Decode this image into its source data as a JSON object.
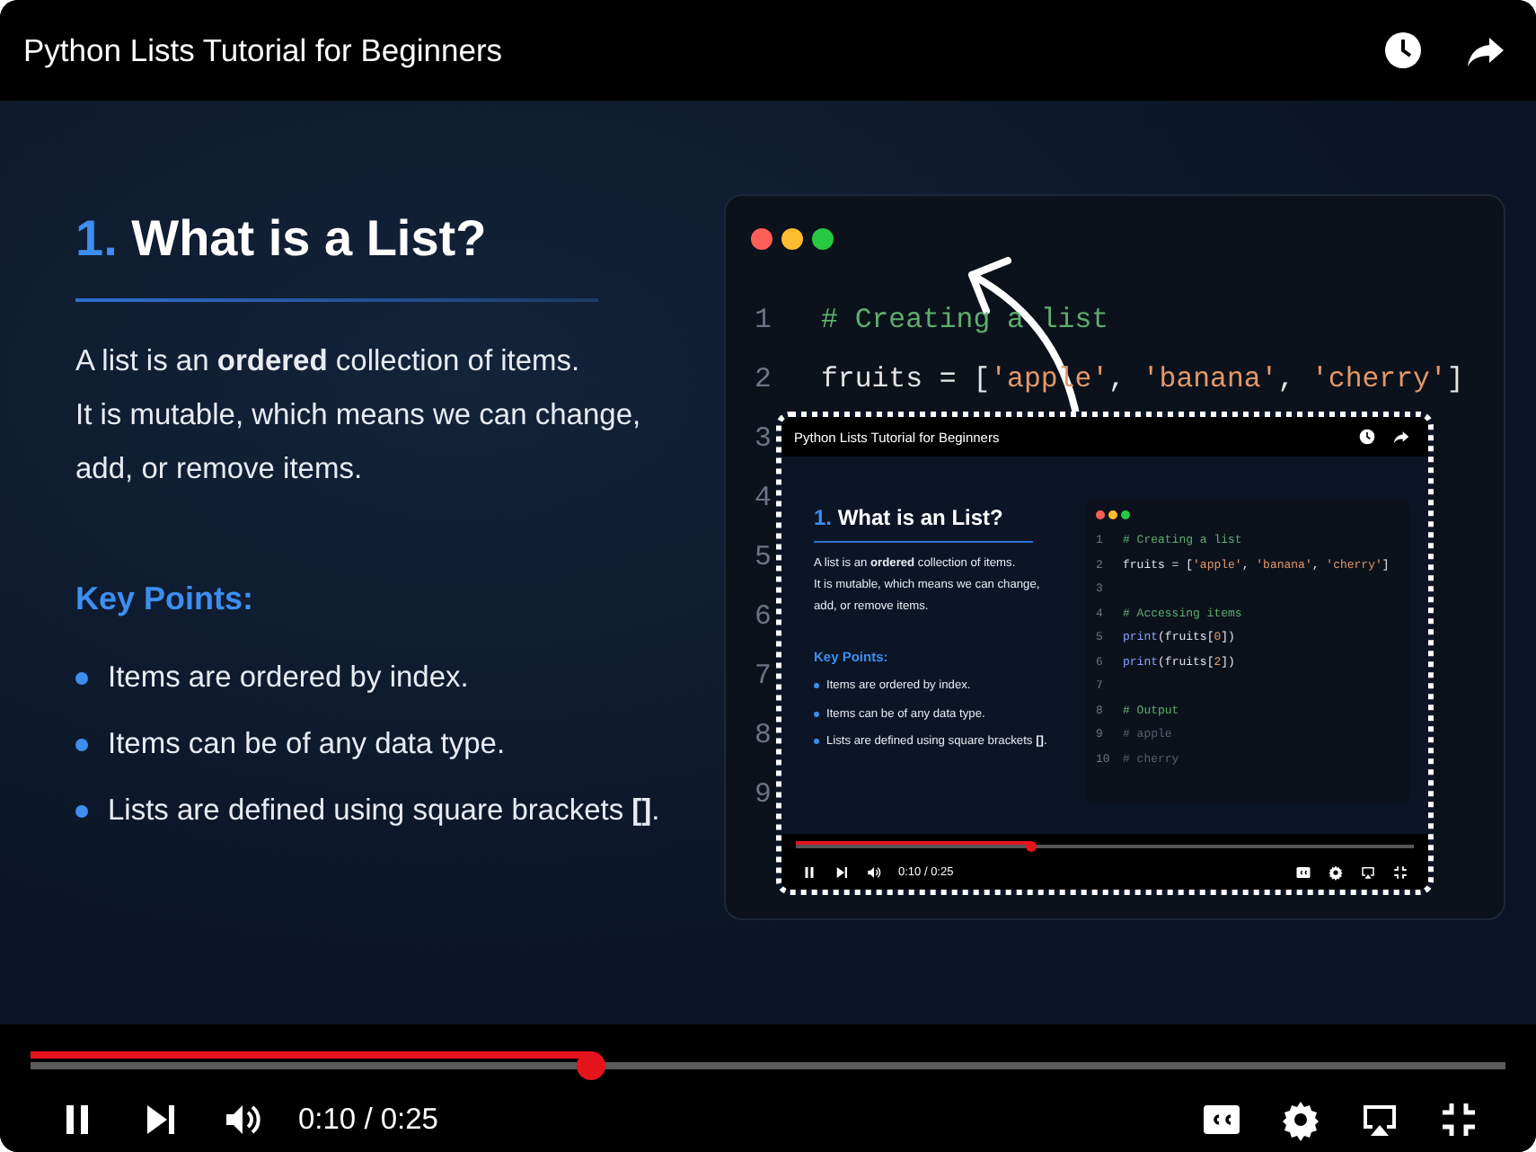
{
  "player": {
    "title": "Python Lists Tutorial for Beginners",
    "progress": {
      "level": 0.38
    },
    "time": "0:10 / 0:25"
  },
  "slide": {
    "number": "1.",
    "heading": "What is a List?",
    "paragraph": [
      "A list is an **ordered** collection of items.",
      "It is mutable, which means we can change,",
      "add, or remove items."
    ],
    "key_points_heading": "Key Points:",
    "key_points": [
      "Items are ordered by index.",
      "Items can be of any data type.",
      "Lists are defined using square brackets **[]**."
    ],
    "code": {
      "lines": [
        {
          "number": "1",
          "tokens": [
            {
              "kind": "comment",
              "text": "# Creating a list"
            }
          ]
        },
        {
          "number": "2",
          "tokens": [
            {
              "kind": "plain",
              "text": "fruits = ["
            },
            {
              "kind": "string",
              "text": "'apple'"
            },
            {
              "kind": "plain",
              "text": ", "
            },
            {
              "kind": "string",
              "text": "'banana'"
            },
            {
              "kind": "plain",
              "text": ", "
            },
            {
              "kind": "string",
              "text": "'cherry'"
            },
            {
              "kind": "plain",
              "text": "]"
            }
          ]
        },
        {
          "number": "3"
        },
        {
          "number": "4"
        },
        {
          "number": "5"
        },
        {
          "number": "6"
        },
        {
          "number": "7"
        },
        {
          "number": "8"
        },
        {
          "number": "9"
        }
      ]
    }
  },
  "inset": {
    "title": "Python Lists Tutorial for Beginners",
    "number": "1.",
    "heading": "What is an List?",
    "paragraph": [
      "A list is an **ordered** collection of items.",
      "It is mutable, which means we can change,",
      "add, or remove items."
    ],
    "key_points_heading": "Key Points:",
    "key_points": [
      "Items are ordered by index.",
      "Items can be of any data type.",
      "Lists are defined using square brackets **[]**."
    ],
    "code": {
      "lines": [
        {
          "number": "1",
          "tokens": [
            {
              "kind": "comment",
              "text": "# Creating a list"
            }
          ]
        },
        {
          "number": "2",
          "tokens": [
            {
              "kind": "plain",
              "text": "fruits = ["
            },
            {
              "kind": "string",
              "text": "'apple'"
            },
            {
              "kind": "plain",
              "text": ", "
            },
            {
              "kind": "string",
              "text": "'banana'"
            },
            {
              "kind": "plain",
              "text": ", "
            },
            {
              "kind": "string",
              "text": "'cherry'"
            },
            {
              "kind": "plain",
              "text": "]"
            }
          ]
        },
        {
          "number": "3"
        },
        {
          "number": "4",
          "tokens": [
            {
              "kind": "comment",
              "text": "# Accessing items"
            }
          ]
        },
        {
          "number": "5",
          "tokens": [
            {
              "kind": "func",
              "text": "print"
            },
            {
              "kind": "plain",
              "text": "(fruits["
            },
            {
              "kind": "number",
              "text": "0"
            },
            {
              "kind": "plain",
              "text": "])"
            }
          ]
        },
        {
          "number": "6",
          "tokens": [
            {
              "kind": "func",
              "text": "print"
            },
            {
              "kind": "plain",
              "text": "(fruits["
            },
            {
              "kind": "number",
              "text": "2"
            },
            {
              "kind": "plain",
              "text": "])"
            }
          ]
        },
        {
          "number": "7"
        },
        {
          "number": "8",
          "tokens": [
            {
              "kind": "comment",
              "text": "# Output"
            }
          ]
        },
        {
          "number": "9",
          "tokens": [
            {
              "kind": "muted",
              "text": "# apple"
            }
          ]
        },
        {
          "number": "10",
          "tokens": [
            {
              "kind": "muted",
              "text": "# cherry"
            }
          ]
        }
      ]
    },
    "progress": {
      "level": 0.38
    },
    "time": "0:10 / 0:25"
  }
}
